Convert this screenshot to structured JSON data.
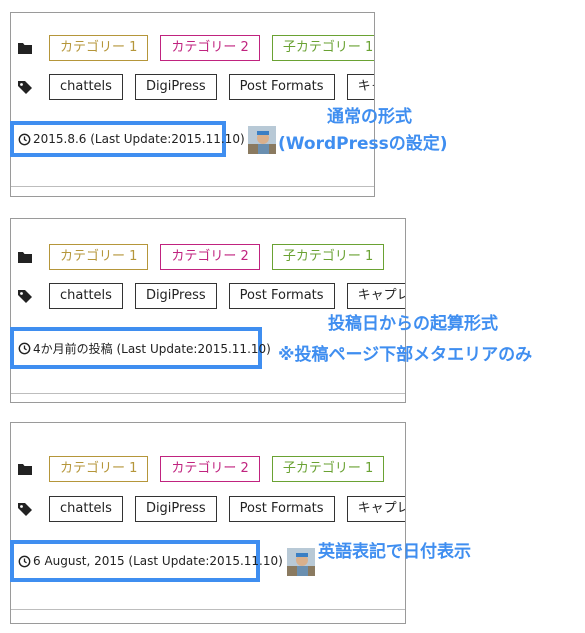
{
  "colors": {
    "accent": "#3f8ef0",
    "category_1": "#b5963a",
    "category_2": "#c0237f",
    "child_category_1": "#6aa233"
  },
  "icons": [
    "folder-icon",
    "tag-icon",
    "clock-icon"
  ],
  "panels": [
    {
      "categories": [
        "カテゴリー 1",
        "カテゴリー 2",
        "子カテゴリー 1"
      ],
      "tags": [
        "chattels",
        "DigiPress",
        "Post Formats",
        "キャプレター"
      ],
      "date_text": "2015.8.6 (Last Update:2015.11.10)",
      "annotation": [
        "通常の形式",
        "(WordPressの設定)"
      ]
    },
    {
      "categories": [
        "カテゴリー 1",
        "カテゴリー 2",
        "子カテゴリー 1"
      ],
      "tags": [
        "chattels",
        "DigiPress",
        "Post Formats",
        "キャプレター"
      ],
      "date_text": "4か月前の投稿 (Last Update:2015.11.10)",
      "annotation": [
        "投稿日からの起算形式",
        "※投稿ページ下部メタエリアのみ"
      ]
    },
    {
      "categories": [
        "カテゴリー 1",
        "カテゴリー 2",
        "子カテゴリー 1"
      ],
      "tags": [
        "chattels",
        "DigiPress",
        "Post Formats",
        "キャプレター"
      ],
      "date_text": "6 August, 2015 (Last Update:2015.11.10)",
      "annotation": [
        "英語表記で日付表示"
      ]
    }
  ]
}
